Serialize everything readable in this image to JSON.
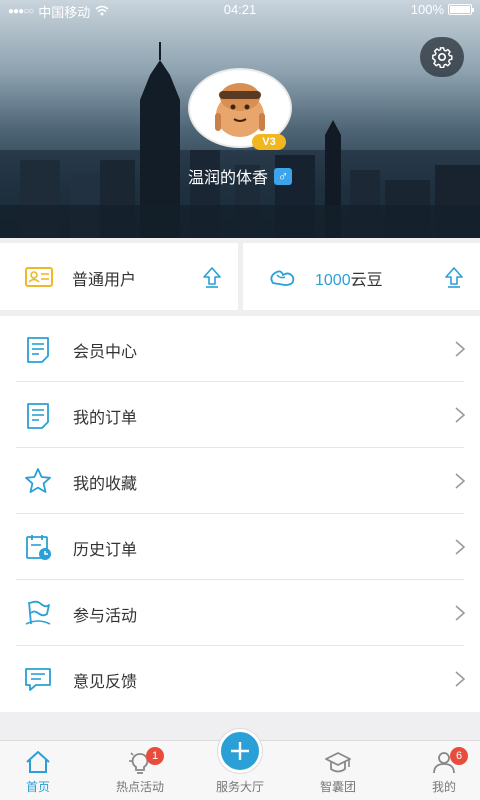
{
  "status_bar": {
    "signal": "●●●○○",
    "carrier": "中国移动",
    "time": "04:21",
    "battery": "100%"
  },
  "profile": {
    "level_badge": "V3",
    "nickname": "温润的体香",
    "gender_symbol": "♂",
    "avatar_icon": "cartoon-avatar-icon",
    "settings_icon": "gear-icon"
  },
  "cards": {
    "user_type": "普通用户",
    "beans_amount": "1000",
    "beans_unit": "云豆"
  },
  "menu": {
    "items": [
      {
        "label": "会员中心",
        "icon": "member-card-icon"
      },
      {
        "label": "我的订单",
        "icon": "order-icon"
      },
      {
        "label": "我的收藏",
        "icon": "star-icon"
      },
      {
        "label": "历史订单",
        "icon": "history-icon"
      },
      {
        "label": "参与活动",
        "icon": "activity-icon"
      },
      {
        "label": "意见反馈",
        "icon": "feedback-icon"
      }
    ]
  },
  "tabbar": {
    "tabs": [
      {
        "label": "首页",
        "icon": "home-icon",
        "active": true
      },
      {
        "label": "热点活动",
        "icon": "bulb-icon",
        "badge": "1"
      },
      {
        "label": "服务大厅",
        "icon": "plus-icon"
      },
      {
        "label": "智囊团",
        "icon": "graduation-cap-icon"
      },
      {
        "label": "我的",
        "icon": "user-icon",
        "badge": "6"
      }
    ]
  },
  "colors": {
    "accent": "#2aa0d6",
    "badge": "#e94b3c",
    "vip": "#f2b71f",
    "gender": "#3da3ea"
  }
}
